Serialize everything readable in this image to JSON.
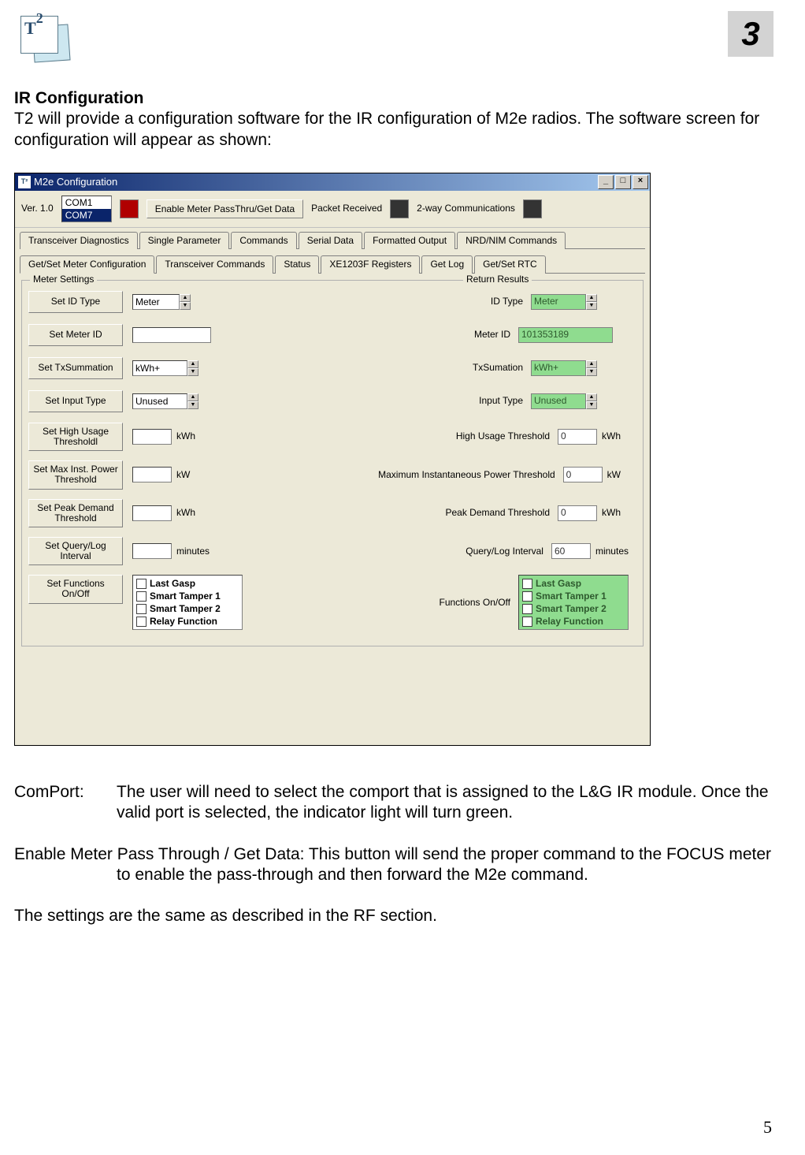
{
  "doc": {
    "logo_text": "T",
    "logo_sup": "2",
    "chapter_number": "3",
    "heading": "IR Configuration",
    "paragraph": "T2 will provide a configuration software for the IR configuration of  M2e radios.  The software screen for configuration will appear as shown:",
    "comport_label": "ComPort:",
    "comport_text": "The user will need to select the comport that is assigned to the L&G IR module.  Once the valid port is selected, the indicator light will turn green.",
    "enable_text": "Enable Meter Pass Through / Get Data:  This button will send the proper command to the FOCUS meter to enable the pass-through and then forward the M2e command.",
    "footer_same": "The settings are the same as described in the RF section.",
    "page_number": "5"
  },
  "app": {
    "title": "M2e Configuration",
    "version": "Ver. 1.0",
    "com_ports": [
      "COM1",
      "COM7"
    ],
    "com_selected": "COM7",
    "enable_btn": "Enable Meter PassThru/Get Data",
    "packet_received": "Packet Received",
    "two_way": "2-way Communications",
    "tabs_row1": [
      "Transceiver Diagnostics",
      "Single Parameter",
      "Commands",
      "Serial Data",
      "Formatted Output",
      "NRD/NIM Commands"
    ],
    "tabs_row2": [
      "Get/Set Meter Configuration",
      "Transceiver Commands",
      "Status",
      "XE1203F Registers",
      "Get Log",
      "Get/Set RTC"
    ],
    "active_tab": "Get/Set Meter Configuration",
    "meter_settings_legend": "Meter Settings",
    "return_results_legend": "Return Results",
    "rows": {
      "id_type": {
        "btn": "Set ID Type",
        "value": "Meter",
        "ret_label": "ID Type",
        "ret_value": "Meter"
      },
      "meter_id": {
        "btn": "Set Meter ID",
        "value": "",
        "ret_label": "Meter ID",
        "ret_value": "101353189"
      },
      "txsum": {
        "btn": "Set TxSummation",
        "value": "kWh+",
        "ret_label": "TxSumation",
        "ret_value": "kWh+"
      },
      "input_type": {
        "btn": "Set Input Type",
        "value": "Unused",
        "ret_label": "Input Type",
        "ret_value": "Unused"
      },
      "high_usage": {
        "btn": "Set High Usage Thresholdl",
        "value": "",
        "unit": "kWh",
        "ret_label": "High Usage Threshold",
        "ret_value": "0",
        "ret_unit": "kWh"
      },
      "max_inst": {
        "btn": "Set Max Inst. Power Threshold",
        "value": "",
        "unit": "kW",
        "ret_label": "Maximum Instantaneous Power Threshold",
        "ret_value": "0",
        "ret_unit": "kW"
      },
      "peak": {
        "btn": "Set Peak Demand Threshold",
        "value": "",
        "unit": "kWh",
        "ret_label": "Peak Demand Threshold",
        "ret_value": "0",
        "ret_unit": "kWh"
      },
      "interval": {
        "btn": "Set Query/Log Interval",
        "value": "",
        "unit": "minutes",
        "ret_label": "Query/Log Interval",
        "ret_value": "60",
        "ret_unit": "minutes"
      },
      "functions": {
        "btn": "Set Functions On/Off",
        "items": [
          "Last Gasp",
          "Smart Tamper 1",
          "Smart Tamper 2",
          "Relay Function"
        ],
        "ret_label": "Functions On/Off"
      }
    }
  }
}
